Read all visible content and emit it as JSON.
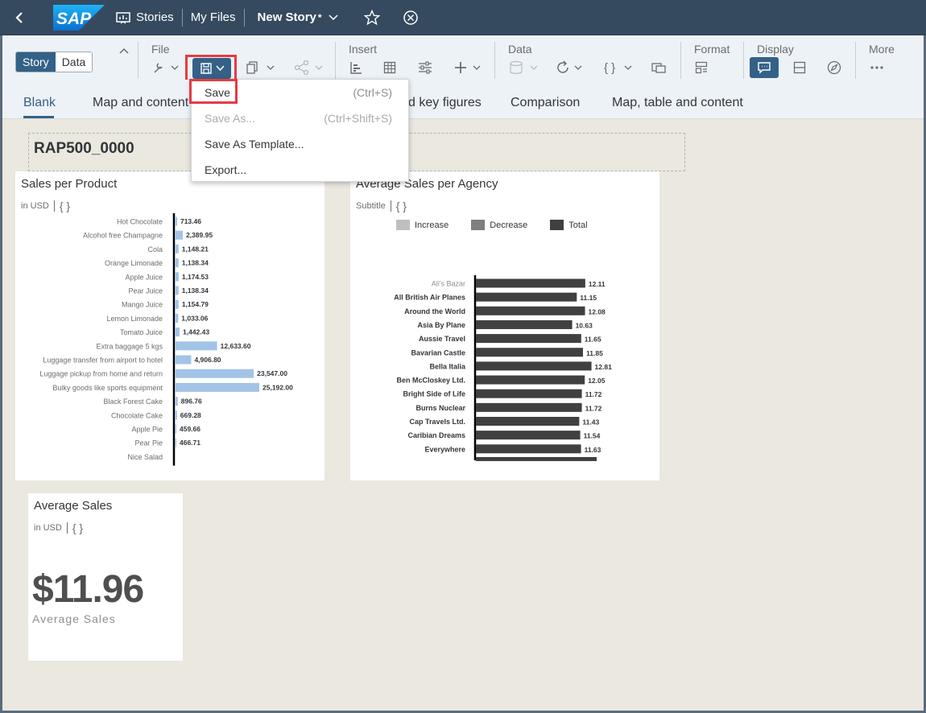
{
  "shell": {
    "stories": "Stories",
    "my_files": "My Files",
    "story_name": "New Story",
    "modified_mark": "*"
  },
  "toolbar": {
    "view_story": "Story",
    "view_data": "Data",
    "groups": {
      "file": "File",
      "insert": "Insert",
      "data": "Data",
      "format": "Format",
      "display": "Display",
      "more": "More"
    }
  },
  "tabs": [
    "Blank",
    "Map and content",
    "d key figures",
    "Comparison",
    "Map, table and content"
  ],
  "save_menu": {
    "items": [
      {
        "label": "Save",
        "shortcut": "(Ctrl+S)",
        "enabled": true
      },
      {
        "label": "Save As...",
        "shortcut": "(Ctrl+Shift+S)",
        "enabled": false
      },
      {
        "label": "Save As Template...",
        "shortcut": "",
        "enabled": true
      },
      {
        "label": "Export...",
        "shortcut": "",
        "enabled": true
      }
    ]
  },
  "story_title": "RAP500_0000",
  "charts": {
    "sales_per_product": {
      "title": "Sales per Product",
      "unit": "in USD",
      "brace": "{ }"
    },
    "avg_sales_agency": {
      "title": "Average Sales per Agency",
      "subtitle": "Subtitle",
      "brace": "{ }",
      "legend": [
        {
          "label": "Increase",
          "color": "#bfbfbf"
        },
        {
          "label": "Decrease",
          "color": "#7f7f7f"
        },
        {
          "label": "Total",
          "color": "#404040"
        }
      ]
    },
    "average_sales": {
      "title": "Average Sales",
      "unit": "in USD",
      "brace": "{ }",
      "value": "$11.96",
      "label": "Average Sales"
    }
  },
  "chart_data": [
    {
      "type": "bar",
      "title": "Sales per Product",
      "subtitle": "in USD",
      "orientation": "horizontal",
      "categories": [
        "Hot Chocolate",
        "Alcohol free Champagne",
        "Cola",
        "Orange Limonade",
        "Apple Juice",
        "Pear Juice",
        "Mango Juice",
        "Lemon Limonade",
        "Tomato Juice",
        "Extra baggage 5 kgs",
        "Luggage transfer from airport to hotel",
        "Luggage pickup from home and return",
        "Bulky goods like sports equipment",
        "Black Forest Cake",
        "Chocolate Cake",
        "Apple Pie",
        "Pear Pie",
        "Nice Salad"
      ],
      "values": [
        713.46,
        2389.95,
        1148.21,
        1138.34,
        1174.53,
        1138.34,
        1154.79,
        1033.06,
        1442.43,
        12633.6,
        4906.8,
        23547.0,
        25192.0,
        896.76,
        669.28,
        459.66,
        466.71,
        null
      ],
      "labels": [
        "713.46",
        "2,389.95",
        "1,148.21",
        "1,138.34",
        "1,174.53",
        "1,138.34",
        "1,154.79",
        "1,033.06",
        "1,442.43",
        "12,633.60",
        "4,906.80",
        "23,547.00",
        "25,192.00",
        "896.76",
        "669.28",
        "459.66",
        "466.71",
        ""
      ],
      "color": "#a3c4e6"
    },
    {
      "type": "bar",
      "title": "Average Sales per Agency",
      "subtitle": "Subtitle",
      "orientation": "horizontal",
      "categories": [
        "Ali's Bazar",
        "All British Air Planes",
        "Around the World",
        "Asia By Plane",
        "Aussie Travel",
        "Bavarian Castle",
        "Bella Italia",
        "Ben McCloskey Ltd.",
        "Bright Side of Life",
        "Burns Nuclear",
        "Cap Travels Ltd.",
        "Caribian Dreams",
        "Everywhere"
      ],
      "values": [
        12.11,
        11.15,
        12.08,
        10.63,
        11.65,
        11.85,
        12.81,
        12.05,
        11.72,
        11.72,
        11.43,
        11.54,
        11.63
      ],
      "labels": [
        "12.11",
        "11.15",
        "12.08",
        "10.63",
        "11.65",
        "11.85",
        "12.81",
        "12.05",
        "11.72",
        "11.72",
        "11.43",
        "11.54",
        "11.63"
      ],
      "color": "#404040"
    }
  ]
}
